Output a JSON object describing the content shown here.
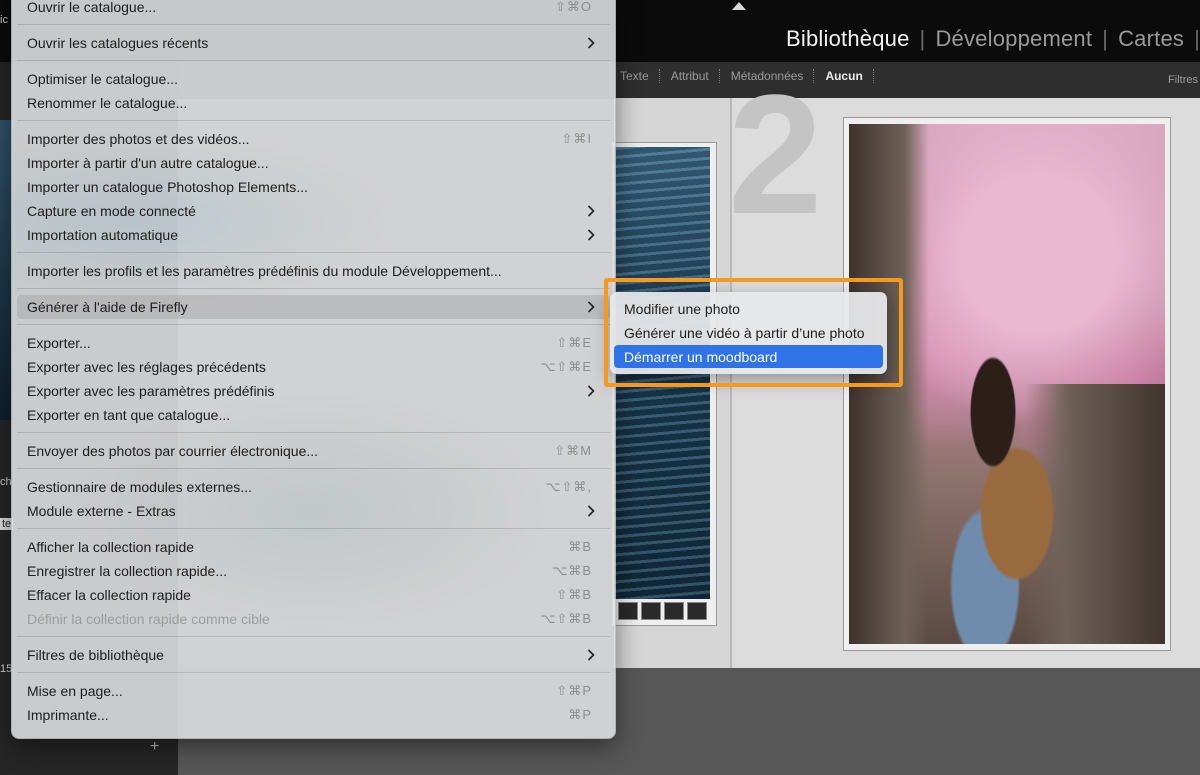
{
  "app": {
    "modules": [
      {
        "label": "Bibliothèque",
        "active": true
      },
      {
        "label": "Développement",
        "active": false
      },
      {
        "label": "Cartes",
        "active": false
      }
    ],
    "filters": [
      {
        "label": "Texte",
        "active": false
      },
      {
        "label": "Attribut",
        "active": false
      },
      {
        "label": "Métadonnées",
        "active": false
      },
      {
        "label": "Aucun",
        "active": true
      }
    ],
    "filters_label": "Filtres",
    "grid_cell_number": "2",
    "left_fragments": [
      "ic",
      "ch",
      "te",
      "15"
    ]
  },
  "menu": {
    "items": [
      {
        "label": "Ouvrir le catalogue...",
        "shortcut": "⇧⌘O"
      },
      {
        "separator": true
      },
      {
        "label": "Ouvrir les catalogues récents",
        "submenu": true
      },
      {
        "separator": true
      },
      {
        "label": "Optimiser le catalogue..."
      },
      {
        "label": "Renommer le catalogue..."
      },
      {
        "separator": true
      },
      {
        "label": "Importer des photos et des vidéos...",
        "shortcut": "⇧⌘I"
      },
      {
        "label": "Importer à partir d'un autre catalogue..."
      },
      {
        "label": "Importer un catalogue Photoshop Elements..."
      },
      {
        "label": "Capture en mode connecté",
        "submenu": true
      },
      {
        "label": "Importation automatique",
        "submenu": true
      },
      {
        "separator": true
      },
      {
        "label": "Importer les profils et les paramètres prédéfinis du module Développement..."
      },
      {
        "separator": true
      },
      {
        "label": "Générer à l'aide de Firefly",
        "submenu": true,
        "highlighted": true
      },
      {
        "separator": true
      },
      {
        "label": "Exporter...",
        "shortcut": "⇧⌘E"
      },
      {
        "label": "Exporter avec les réglages précédents",
        "shortcut": "⌥⇧⌘E"
      },
      {
        "label": "Exporter avec les paramètres prédéfinis",
        "submenu": true
      },
      {
        "label": "Exporter en tant que catalogue..."
      },
      {
        "separator": true
      },
      {
        "label": "Envoyer des photos par courrier électronique...",
        "shortcut": "⇧⌘M"
      },
      {
        "separator": true
      },
      {
        "label": "Gestionnaire de modules externes...",
        "shortcut": "⌥⇧⌘,"
      },
      {
        "label": "Module externe - Extras",
        "submenu": true
      },
      {
        "separator": true
      },
      {
        "label": "Afficher la collection rapide",
        "shortcut": "⌘B"
      },
      {
        "label": "Enregistrer la collection rapide...",
        "shortcut": "⌥⌘B"
      },
      {
        "label": "Effacer la collection rapide",
        "shortcut": "⇧⌘B"
      },
      {
        "label": "Définir la collection rapide comme cible",
        "shortcut": "⌥⇧⌘B",
        "disabled": true
      },
      {
        "separator": true
      },
      {
        "label": "Filtres de bibliothèque",
        "submenu": true
      },
      {
        "separator": true
      },
      {
        "label": "Mise en page...",
        "shortcut": "⇧⌘P"
      },
      {
        "label": "Imprimante...",
        "shortcut": "⌘P"
      }
    ]
  },
  "submenu": {
    "items": [
      {
        "label": "Modifier une photo",
        "selected": false
      },
      {
        "label": "Générer une vidéo à partir d’une photo",
        "selected": false
      },
      {
        "label": "Démarrer un moodboard",
        "selected": true
      }
    ]
  },
  "colors": {
    "selection_blue": "#2f73e6",
    "callout_orange": "#f59a1e"
  }
}
